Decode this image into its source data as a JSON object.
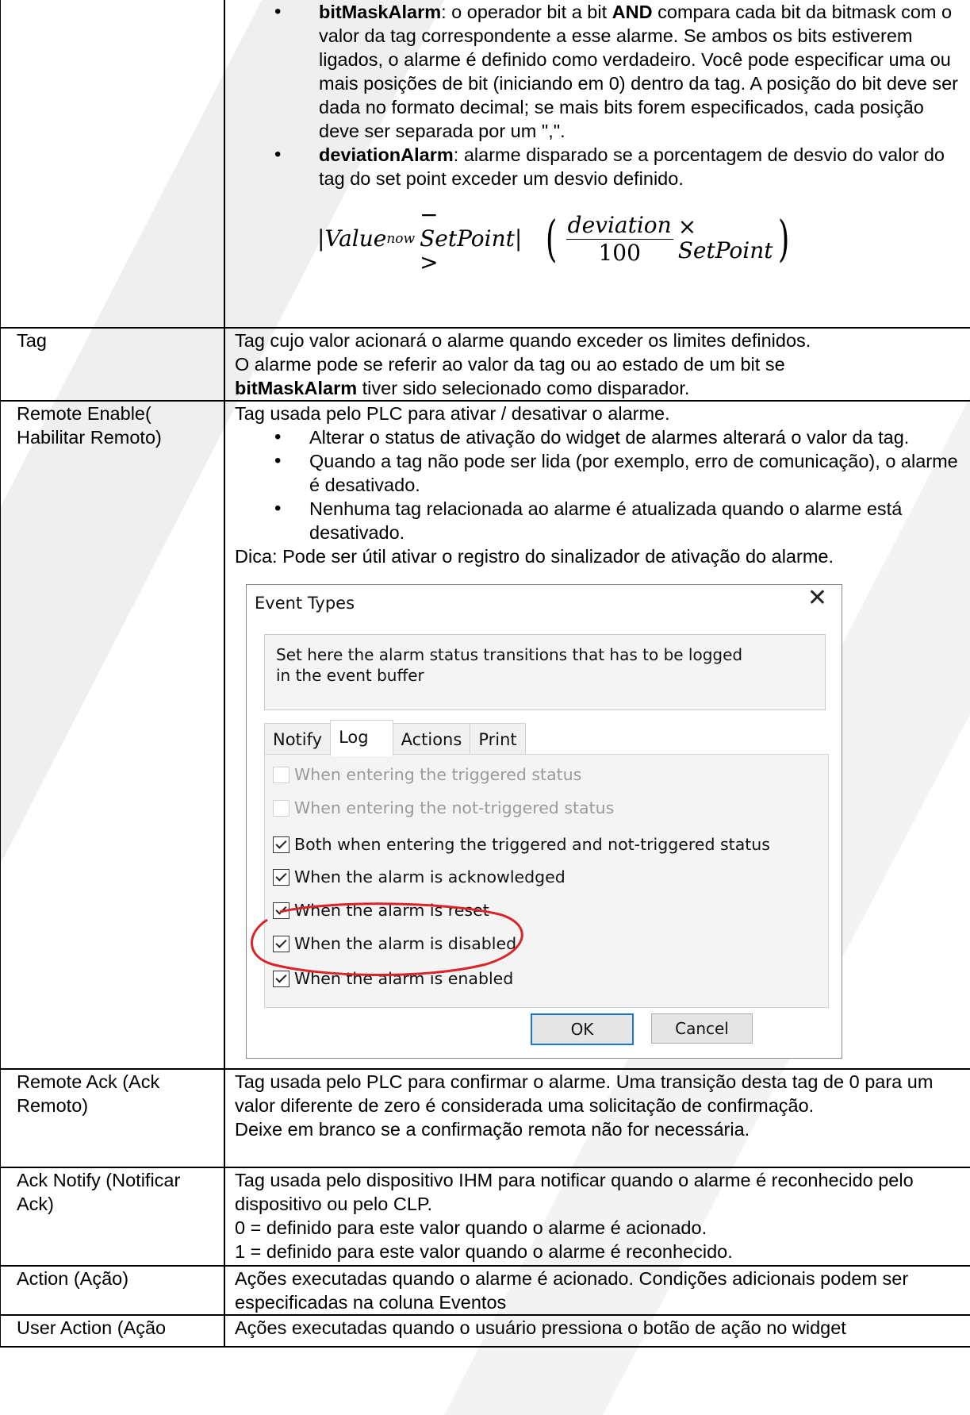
{
  "rows": {
    "alarm_types_cont": {
      "bullets": [
        {
          "term": "bitMaskAlarm",
          "pre": ": o operador bit a bit ",
          "bold": "AND",
          "post": " compara cada bit da bitmask com o valor da tag correspondente a esse alarme. Se ambos os bits estiverem ligados, o alarme é definido como verdadeiro. Você pode especificar uma ou mais posições de bit (iniciando em 0) dentro da tag. A posição do bit deve ser dada no formato decimal; se mais bits forem especificados, cada posição deve ser separada por um  \",\"."
        },
        {
          "term": "deviationAlarm",
          "post": ": alarme disparado se a porcentagem de desvio do valor do tag do set point exceder um desvio definido."
        }
      ],
      "formula": {
        "value": "Value",
        "sub": "now",
        "minus": "− SetPoint| > ",
        "bar_open": "|",
        "num": "deviation",
        "den": "100",
        "times": "× SetPoint"
      }
    },
    "tag": {
      "label": "Tag",
      "lines": [
        "Tag cujo valor acionará o alarme quando exceder os limites definidos.",
        "O alarme pode se referir ao valor da tag ou ao estado de um bit se"
      ],
      "bold": "bitMaskAlarm",
      "tail": " tiver sido selecionado como disparador."
    },
    "remote_enable": {
      "label": "Remote Enable( Habilitar Remoto)",
      "intro": "Tag usada pelo PLC para ativar / desativar o alarme.",
      "bullets": [
        "Alterar o status de ativação do widget de alarmes alterará o valor da tag.",
        "Quando a tag não pode ser lida (por exemplo, erro de comunicação), o alarme é desativado.",
        "Nenhuma tag relacionada ao alarme é atualizada quando o alarme está desativado."
      ],
      "tip": "Dica: Pode ser útil ativar o registro do sinalizador de ativação do alarme."
    },
    "remote_ack": {
      "label": "Remote Ack (Ack Remoto)",
      "text": "Tag usada pelo PLC para confirmar o alarme. Uma transição desta tag de 0 para um valor diferente de zero é considerada uma solicitação de confirmação.",
      "text2": "Deixe em branco se a confirmação remota não for necessária."
    },
    "ack_notify": {
      "label": "Ack Notify (Notificar Ack)",
      "text": "Tag usada pelo dispositivo IHM para notificar quando o alarme é reconhecido pelo dispositivo ou pelo CLP.",
      "line0": "0 = definido para este valor quando o alarme é acionado.",
      "line1": "1 = definido para este valor quando o alarme é reconhecido."
    },
    "action": {
      "label": "Action (Ação)",
      "text": "Ações executadas quando o alarme é acionado. Condições adicionais podem ser especificadas na coluna Eventos"
    },
    "user_action": {
      "label": "User Action (Ação",
      "text": "Ações executadas quando o usuário pressiona o botão de ação no widget"
    }
  },
  "dialog": {
    "title": "Event Types",
    "close_icon": "close-icon",
    "description": "Set here the alarm status transitions that has to be logged in the event buffer",
    "tabs": [
      "Notify",
      "Log",
      "Actions",
      "Print"
    ],
    "active_tab": "Log",
    "options": [
      {
        "label": "When entering the triggered status",
        "checked": false,
        "disabled": true
      },
      {
        "label": "When entering the not-triggered status",
        "checked": false,
        "disabled": true
      },
      {
        "label": "Both when entering the triggered and not-triggered status",
        "checked": true,
        "disabled": false
      },
      {
        "label": "When the alarm is acknowledged",
        "checked": true,
        "disabled": false
      },
      {
        "label": "When the alarm is reset",
        "checked": true,
        "disabled": false
      },
      {
        "label": "When the alarm is disabled",
        "checked": true,
        "disabled": false
      },
      {
        "label": "When the alarm is enabled",
        "checked": true,
        "disabled": false
      }
    ],
    "ok_label": "OK",
    "cancel_label": "Cancel",
    "highlight_color": "#d9242b"
  },
  "colors": {
    "border": "#000000",
    "ok_border": "#1976d2",
    "decor": "#eeeeee"
  }
}
